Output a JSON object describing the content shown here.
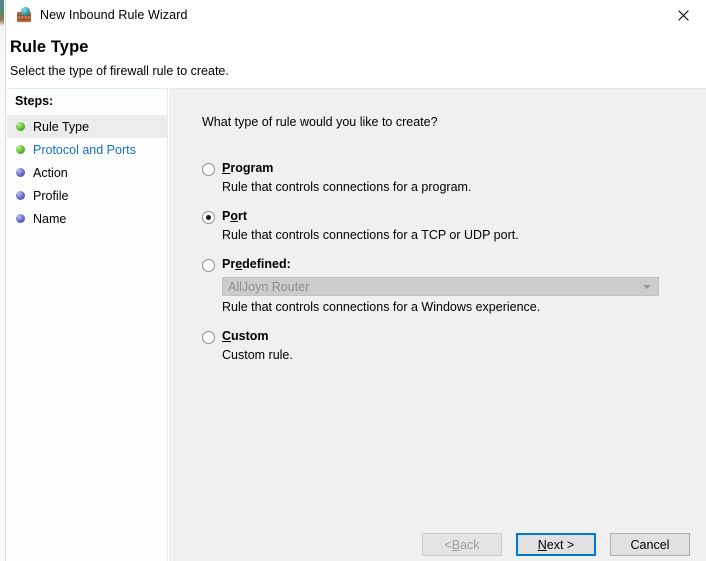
{
  "window": {
    "title": "New Inbound Rule Wizard",
    "icon": "firewall-icon",
    "close_label": "✕"
  },
  "header": {
    "title": "Rule Type",
    "subtitle": "Select the type of firewall rule to create."
  },
  "sidebar": {
    "heading": "Steps:",
    "items": [
      {
        "label": "Rule Type",
        "bullet": "green",
        "state": "active",
        "link": false
      },
      {
        "label": "Protocol and Ports",
        "bullet": "green",
        "state": "next",
        "link": true
      },
      {
        "label": "Action",
        "bullet": "blue",
        "state": "pending",
        "link": false
      },
      {
        "label": "Profile",
        "bullet": "blue",
        "state": "pending",
        "link": false
      },
      {
        "label": "Name",
        "bullet": "blue",
        "state": "pending",
        "link": false
      }
    ]
  },
  "main": {
    "question": "What type of rule would you like to create?",
    "options": [
      {
        "id": "program",
        "label_pre": "",
        "label_accel": "P",
        "label_post": "rogram",
        "description": "Rule that controls connections for a program.",
        "selected": false
      },
      {
        "id": "port",
        "label_pre": "P",
        "label_accel": "o",
        "label_post": "rt",
        "description": "Rule that controls connections for a TCP or UDP port.",
        "selected": true
      },
      {
        "id": "predefined",
        "label_pre": "Pr",
        "label_accel": "e",
        "label_post": "defined:",
        "description": "Rule that controls connections for a Windows experience.",
        "selected": false,
        "combo_value": "AllJoyn Router",
        "combo_disabled": true
      },
      {
        "id": "custom",
        "label_pre": "",
        "label_accel": "C",
        "label_post": "ustom",
        "description": "Custom rule.",
        "selected": false
      }
    ]
  },
  "buttons": {
    "back": {
      "pre": "< ",
      "accel": "B",
      "post": "ack",
      "disabled": true,
      "default": false
    },
    "next": {
      "pre": "",
      "accel": "N",
      "post": "ext >",
      "disabled": false,
      "default": true
    },
    "cancel": {
      "label": "Cancel",
      "disabled": false,
      "default": false
    }
  },
  "colors": {
    "accent": "#0078d7",
    "link": "#1b6fc4",
    "content_bg": "#f0f0f0",
    "sidebar_bg": "#fcfdfd",
    "step_active_bg": "#ececec",
    "bullet_green": "#57b22c",
    "bullet_blue": "#5b5fc2"
  }
}
